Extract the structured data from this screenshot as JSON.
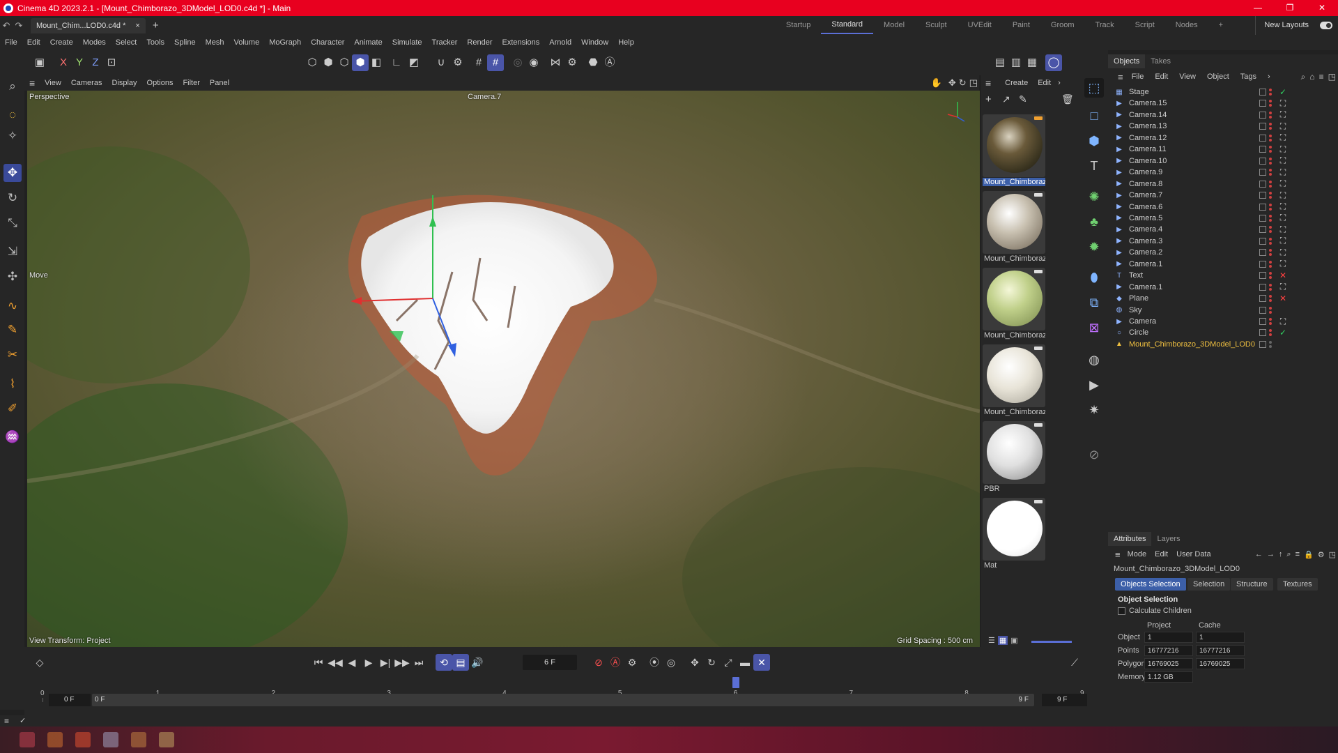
{
  "window": {
    "title": "Cinema 4D 2023.2.1 - [Mount_Chimborazo_3DModel_LOD0.c4d *] - Main",
    "controls": [
      "—",
      "❐",
      "✕"
    ]
  },
  "tabbar": {
    "doc_tab": "Mount_Chim...LOD0.c4d *",
    "close": "×",
    "add": "+",
    "layouts": [
      "Startup",
      "Standard",
      "Model",
      "Sculpt",
      "UVEdit",
      "Paint",
      "Groom",
      "Track",
      "Script",
      "Nodes"
    ],
    "active_layout": "Standard",
    "add_layout": "+",
    "new_layouts": "New Layouts"
  },
  "menubar": [
    "File",
    "Edit",
    "Create",
    "Modes",
    "Select",
    "Tools",
    "Spline",
    "Mesh",
    "Volume",
    "MoGraph",
    "Character",
    "Animate",
    "Simulate",
    "Tracker",
    "Render",
    "Extensions",
    "Arnold",
    "Window",
    "Help"
  ],
  "toolbar": {
    "axis_x": "X",
    "axis_y": "Y",
    "axis_z": "Z"
  },
  "viewport_menu": [
    "View",
    "Cameras",
    "Display",
    "Options",
    "Filter",
    "Panel"
  ],
  "viewport": {
    "projection": "Perspective",
    "camera": "Camera.7",
    "tool": "Move",
    "view_transform": "View Transform: Project",
    "grid_spacing": "Grid Spacing : 500 cm"
  },
  "materials_menu": [
    "Create",
    "Edit"
  ],
  "materials": [
    {
      "name": "Mount_Chimborazo",
      "selected": true
    },
    {
      "name": "Mount_Chimborazo",
      "selected": false
    },
    {
      "name": "Mount_Chimborazo",
      "selected": false
    },
    {
      "name": "Mount_Chimborazo",
      "selected": false
    },
    {
      "name": "PBR",
      "selected": false
    },
    {
      "name": "Mat",
      "selected": false
    }
  ],
  "objects_panel": {
    "tabs": [
      "Objects",
      "Takes"
    ],
    "active_tab": "Objects",
    "menu": [
      "File",
      "Edit",
      "View",
      "Object",
      "Tags"
    ],
    "objects": [
      {
        "name": "Stage",
        "icon": "stage-icon",
        "tag": "check-icon"
      },
      {
        "name": "Camera.15",
        "icon": "camera-icon",
        "tag": "target-icon"
      },
      {
        "name": "Camera.14",
        "icon": "camera-icon",
        "tag": "target-icon"
      },
      {
        "name": "Camera.13",
        "icon": "camera-icon",
        "tag": "target-icon"
      },
      {
        "name": "Camera.12",
        "icon": "camera-icon",
        "tag": "target-icon"
      },
      {
        "name": "Camera.11",
        "icon": "camera-icon",
        "tag": "target-icon"
      },
      {
        "name": "Camera.10",
        "icon": "camera-icon",
        "tag": "target-icon"
      },
      {
        "name": "Camera.9",
        "icon": "camera-icon",
        "tag": "target-icon"
      },
      {
        "name": "Camera.8",
        "icon": "camera-icon",
        "tag": "target-icon"
      },
      {
        "name": "Camera.7",
        "icon": "camera-icon",
        "tag": "target-icon"
      },
      {
        "name": "Camera.6",
        "icon": "camera-icon",
        "tag": "target-icon"
      },
      {
        "name": "Camera.5",
        "icon": "camera-icon",
        "tag": "target-icon"
      },
      {
        "name": "Camera.4",
        "icon": "camera-icon",
        "tag": "target-icon"
      },
      {
        "name": "Camera.3",
        "icon": "camera-icon",
        "tag": "target-icon"
      },
      {
        "name": "Camera.2",
        "icon": "camera-icon",
        "tag": "target-icon"
      },
      {
        "name": "Camera.1",
        "icon": "camera-icon",
        "tag": "target-icon"
      },
      {
        "name": "Text",
        "icon": "text-icon",
        "tag": "x-icon"
      },
      {
        "name": "Camera.1",
        "icon": "camera-icon",
        "tag": "target-icon"
      },
      {
        "name": "Plane",
        "icon": "plane-icon",
        "tag": "x-icon"
      },
      {
        "name": "Sky",
        "icon": "sky-icon",
        "tag": ""
      },
      {
        "name": "Camera",
        "icon": "camera-icon",
        "tag": "target-icon"
      },
      {
        "name": "Circle",
        "icon": "circle-icon",
        "tag": "check-icon"
      },
      {
        "name": "Mount_Chimborazo_3DModel_LOD0",
        "icon": "mesh-icon",
        "tag": "",
        "highlight": true
      }
    ]
  },
  "attributes": {
    "tabs": [
      "Attributes",
      "Layers"
    ],
    "active_tab": "Attributes",
    "menu": [
      "Mode",
      "Edit",
      "User Data"
    ],
    "object_name": "Mount_Chimborazo_3DModel_LOD0",
    "sub_tabs": [
      "Objects Selection",
      "Selection",
      "Structure",
      "Textures"
    ],
    "active_sub_tab": "Objects Selection",
    "section_title": "Object Selection",
    "calculate_children": "Calculate Children",
    "col_project": "Project",
    "col_cache": "Cache",
    "rows": [
      {
        "label": "Object",
        "project": "1",
        "cache": "1"
      },
      {
        "label": "Points",
        "project": "16777216",
        "cache": "16777216"
      },
      {
        "label": "Polygons",
        "project": "16769025",
        "cache": "16769025"
      },
      {
        "label": "Memory",
        "project": "1.12 GB",
        "cache": ""
      }
    ]
  },
  "timeline": {
    "current_frame": "6 F",
    "ticks": [
      "0",
      "1",
      "2",
      "3",
      "4",
      "5",
      "6",
      "7",
      "8",
      "9"
    ],
    "playhead_frame": 6,
    "range_start": "0 F",
    "range_start_inner": "0 F",
    "range_end_inner": "9 F",
    "range_end": "9 F"
  },
  "colors": {
    "titlebar": "#e8001f",
    "accent": "#4a55a8",
    "selection": "#3c5fa8",
    "highlight_object": "#f0c040"
  }
}
